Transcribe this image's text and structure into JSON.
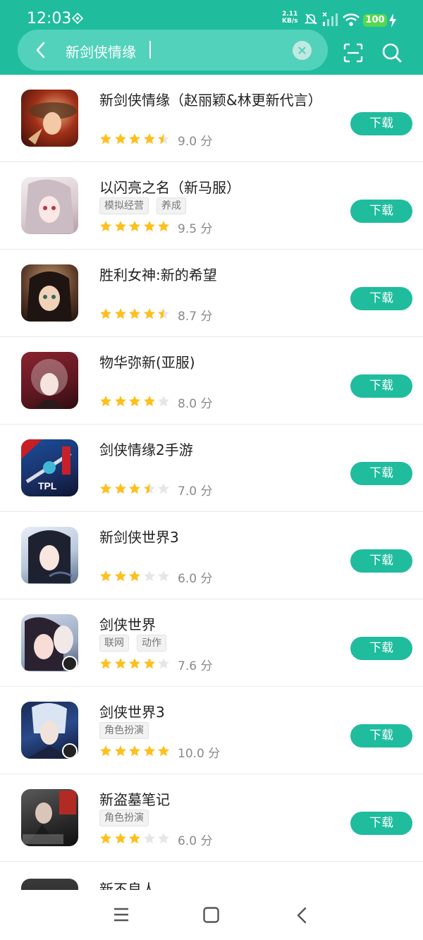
{
  "status": {
    "time": "12:03",
    "speed_value": "2.11",
    "speed_unit": "KB/s",
    "battery": "100"
  },
  "search": {
    "query": "新剑侠情缘",
    "back_icon": "back-arrow-icon",
    "clear_icon": "clear-icon",
    "scan_icon": "scan-icon",
    "search_icon": "search-icon"
  },
  "colors": {
    "accent": "#20bc9e",
    "search_box": "#52d2bb",
    "star": "#ffbf1c",
    "star_empty": "#e6e6e6",
    "battery": "#55d84f"
  },
  "results": [
    {
      "name": "新剑侠情缘（赵丽颖&林更新代言）",
      "tags": [],
      "rating": 4.5,
      "score": "9.0 分",
      "button": "下载"
    },
    {
      "name": "以闪亮之名（新马服）",
      "tags": [
        "模拟经营",
        "养成"
      ],
      "rating": 5,
      "score": "9.5 分",
      "button": "下载"
    },
    {
      "name": "胜利女神:新的希望",
      "tags": [],
      "rating": 4.5,
      "score": "8.7 分",
      "button": "下载"
    },
    {
      "name": "物华弥新(亚服)",
      "tags": [],
      "rating": 4,
      "score": "8.0 分",
      "button": "下载"
    },
    {
      "name": "剑侠情缘2手游",
      "tags": [],
      "rating": 3.5,
      "score": "7.0 分",
      "button": "下载",
      "icon_text": "TPL"
    },
    {
      "name": "新剑侠世界3",
      "tags": [],
      "rating": 3,
      "score": "6.0 分",
      "button": "下载"
    },
    {
      "name": "剑侠世界",
      "tags": [
        "联网",
        "动作"
      ],
      "rating": 4,
      "score": "7.6 分",
      "button": "下载"
    },
    {
      "name": "剑侠世界3",
      "tags": [
        "角色扮演"
      ],
      "rating": 5,
      "score": "10.0 分",
      "button": "下载"
    },
    {
      "name": "新盗墓笔记",
      "tags": [
        "角色扮演"
      ],
      "rating": 3,
      "score": "6.0 分",
      "button": "下载"
    },
    {
      "name": "新不良人",
      "tags": [],
      "rating": 0,
      "score": "",
      "button": ""
    }
  ],
  "nav": {
    "menu_icon": "menu-icon",
    "home_icon": "home-icon",
    "back_icon": "back-icon"
  }
}
